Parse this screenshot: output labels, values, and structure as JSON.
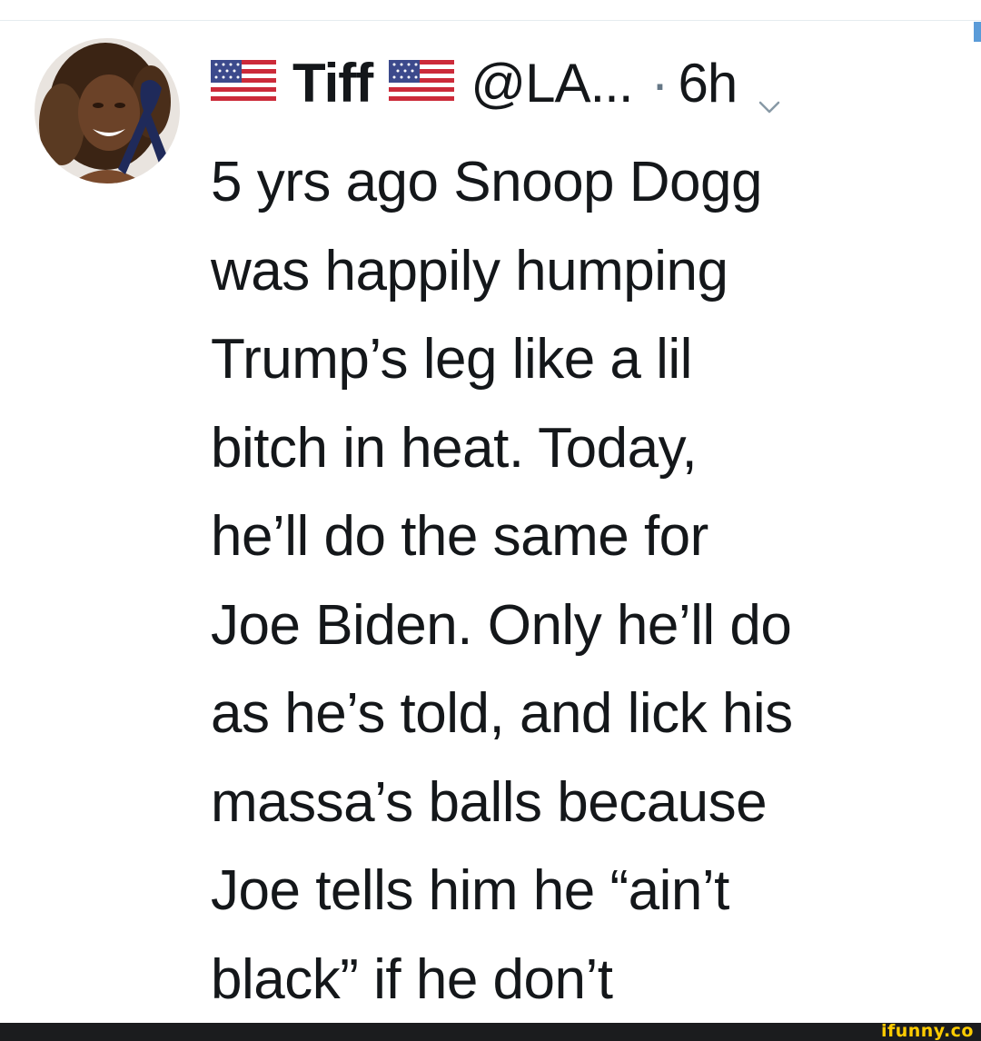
{
  "tweet": {
    "display_name": "Tiff",
    "handle": "@LA...",
    "separator": "·",
    "time": "6h",
    "menu_icon": "chevron-down-icon",
    "flag_icon": "us-flag-icon",
    "avatar_icon": "avatar-photo",
    "text_lines": [
      "5 yrs ago Snoop Dogg",
      "was happily humping",
      "Trump’s leg like a lil",
      "bitch in heat. Today,",
      "he’ll do the same for",
      "Joe Biden. Only he’ll do",
      "as he’s told, and lick his",
      "massa’s balls because",
      "Joe tells him he “ain’t",
      "black” if he don’t"
    ]
  },
  "watermark": {
    "text": "ifunny.co"
  },
  "colors": {
    "text": "#14171a",
    "secondary": "#657786",
    "footer": "#1b1c1e",
    "watermark": "#ffcc00",
    "ribbon": "#1f2a5a"
  }
}
